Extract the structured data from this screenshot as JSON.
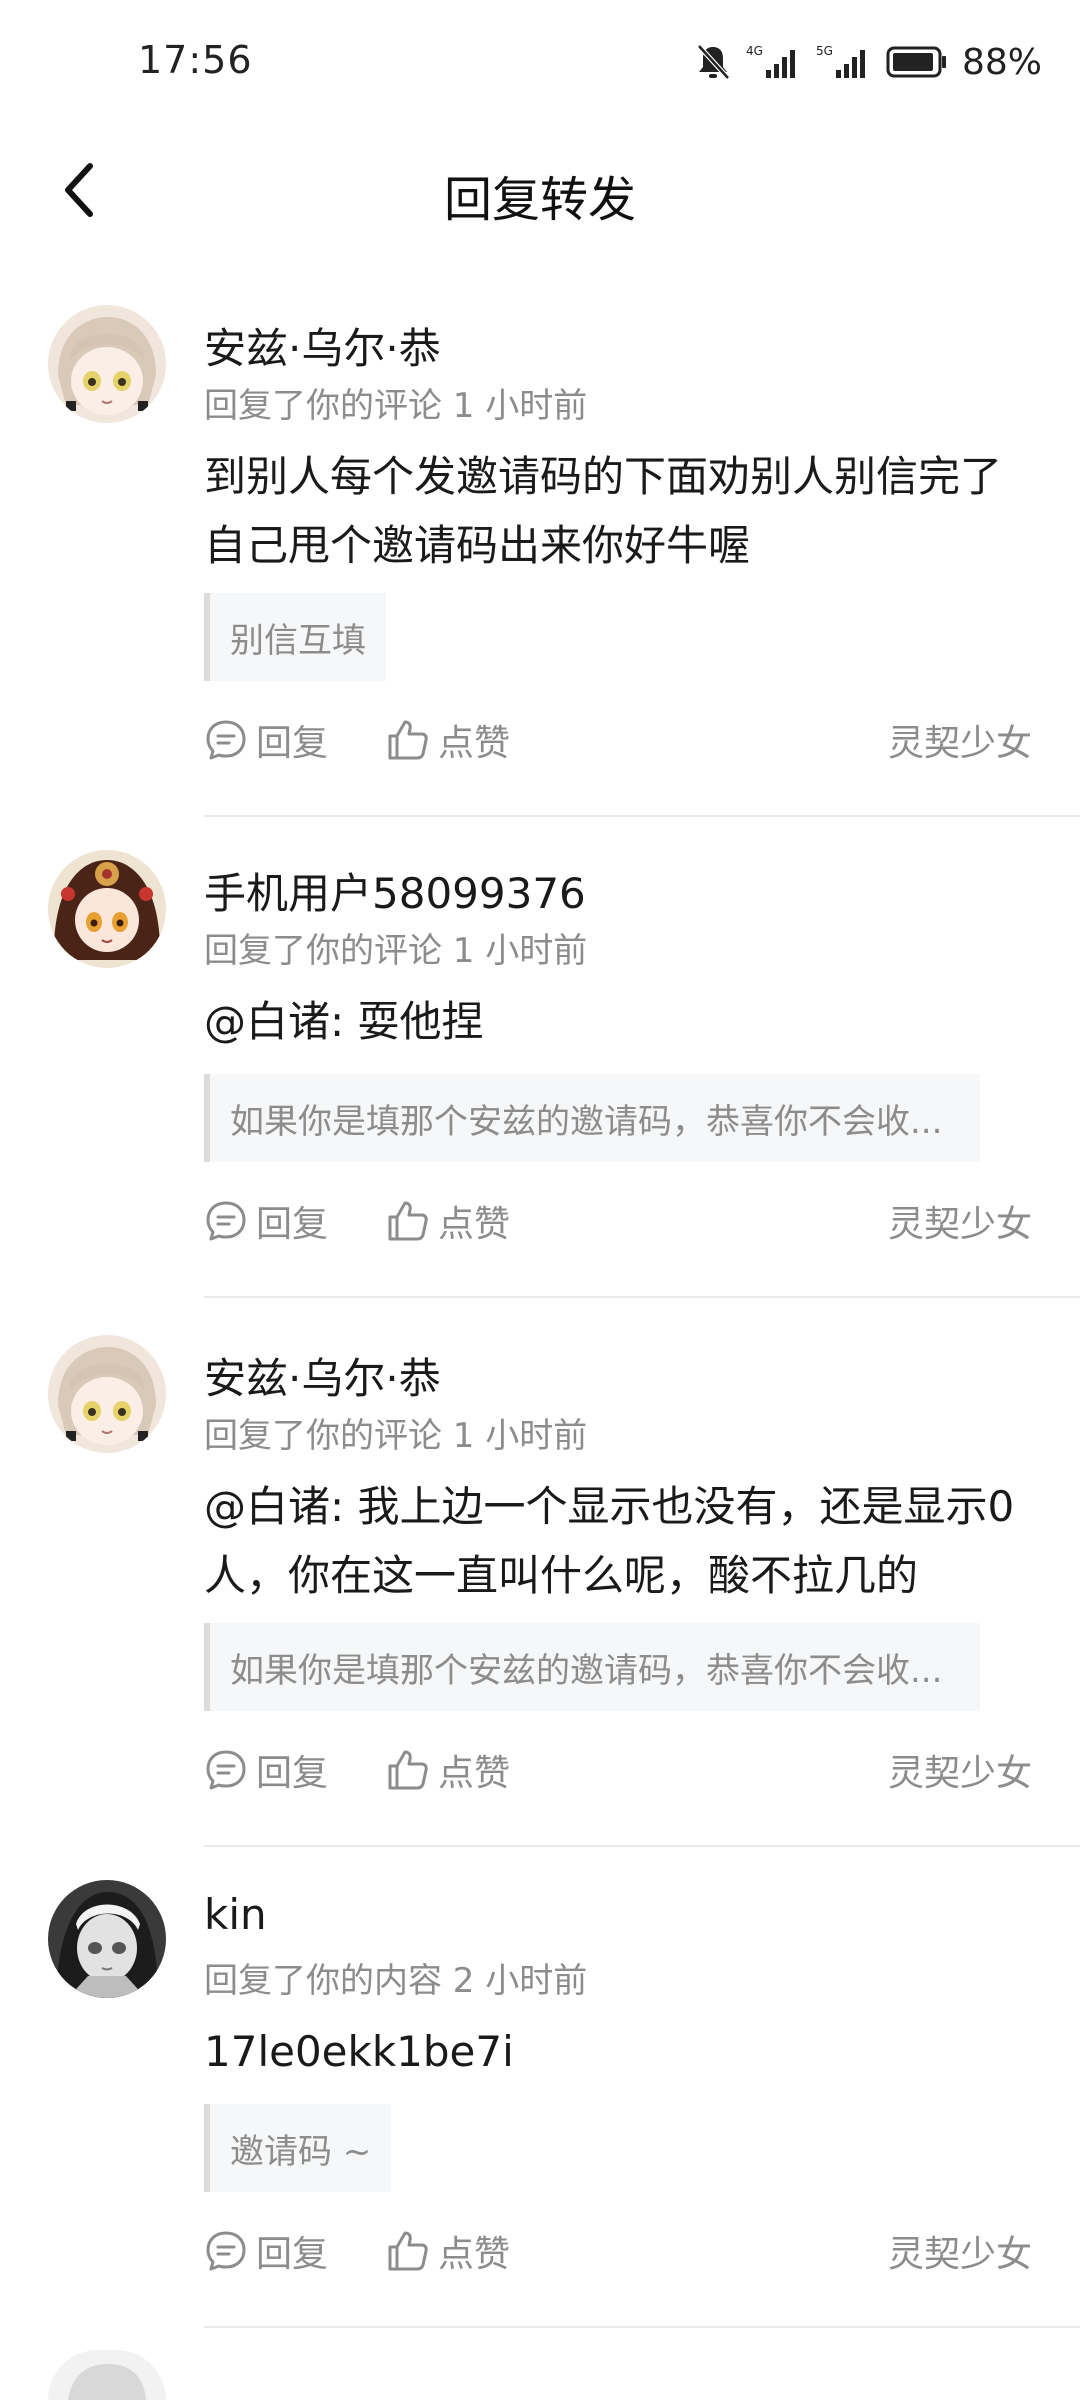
{
  "status_bar": {
    "time": "17:56",
    "battery_percent": "88%",
    "network_1": "4G",
    "network_2": "5G",
    "icons": [
      "mute-bell-icon",
      "signal-4g-icon",
      "signal-5g-icon",
      "battery-icon"
    ]
  },
  "header": {
    "title": "回复转发",
    "back_icon": "back-arrow-icon"
  },
  "actions": {
    "reply_label": "回复",
    "like_label": "点赞"
  },
  "items": [
    {
      "username": "安兹·乌尔·恭",
      "meta": "回复了你的评论 1 小时前",
      "comment_lines": [
        "到别人每个发邀请码的下面劝别人别信完了",
        "自己甩个邀请码出来你好牛喔"
      ],
      "quote": "别信互填",
      "source": "灵契少女",
      "avatar": "avatar-light-hair"
    },
    {
      "username": "手机用户58099376",
      "meta": "回复了你的评论 1 小时前",
      "comment_lines": [
        "@白诸: 耍他捏"
      ],
      "quote": "如果你是填那个安兹的邀请码，恭喜你不会收...",
      "source": "灵契少女",
      "avatar": "avatar-dark-hair"
    },
    {
      "username": "安兹·乌尔·恭",
      "meta": "回复了你的评论 1 小时前",
      "comment_lines": [
        "@白诸: 我上边一个显示也没有，还是显示0",
        "人，你在这一直叫什么呢，酸不拉几的"
      ],
      "quote": "如果你是填那个安兹的邀请码，恭喜你不会收...",
      "source": "灵契少女",
      "avatar": "avatar-light-hair"
    },
    {
      "username": "kin",
      "meta": "回复了你的内容 2 小时前",
      "comment_lines": [
        "17le0ekk1be7i"
      ],
      "quote": "邀请码 ~",
      "source": "灵契少女",
      "avatar": "avatar-grey-hood"
    }
  ],
  "colors": {
    "background": "#ffffff",
    "primary_text": "#1a1a1a",
    "secondary_text": "#8c8c8c",
    "quote_background": "#f6f7f8",
    "quote_border": "#dcdcdc",
    "divider": "#e9e9e9"
  }
}
